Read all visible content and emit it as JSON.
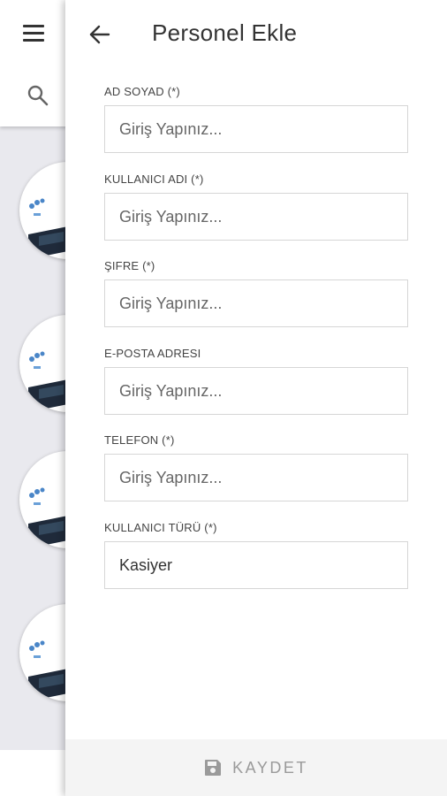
{
  "panel": {
    "title": "Personel Ekle",
    "fields": [
      {
        "label": "AD SOYAD (*)",
        "placeholder": "Giriş Yapınız...",
        "value": ""
      },
      {
        "label": "KULLANICI ADI (*)",
        "placeholder": "Giriş Yapınız...",
        "value": ""
      },
      {
        "label": "ŞIFRE (*)",
        "placeholder": "Giriş Yapınız...",
        "value": ""
      },
      {
        "label": "E-POSTA ADRESI",
        "placeholder": "Giriş Yapınız...",
        "value": ""
      },
      {
        "label": "TELEFON (*)",
        "placeholder": "Giriş Yapınız...",
        "value": ""
      },
      {
        "label": "KULLANICI TÜRÜ (*)",
        "selected": "Kasiyer"
      }
    ],
    "save_label": "KAYDET"
  },
  "icons": {
    "menu": "menu-icon",
    "search": "search-icon",
    "back": "arrow-left-icon",
    "save": "floppy-disk-icon"
  },
  "colors": {
    "overlay_background": "#e9e9ee",
    "title_text": "#333333",
    "footer_background": "#f4f4f4",
    "save_text": "#9a9a9a"
  }
}
